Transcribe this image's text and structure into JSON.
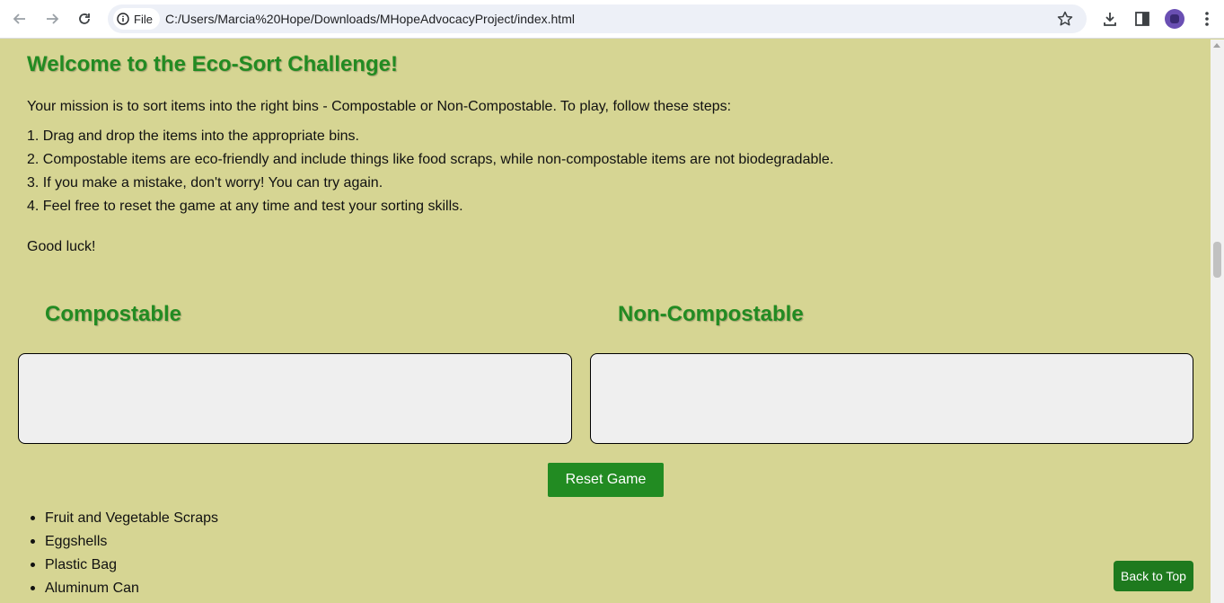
{
  "browser": {
    "chip_label": "File",
    "url": "C:/Users/Marcia%20Hope/Downloads/MHopeAdvocacyProject/index.html",
    "icons": [
      "back-arrow-icon",
      "forward-arrow-icon",
      "reload-icon",
      "info-icon",
      "star-icon",
      "download-icon",
      "side-panel-icon",
      "profile-avatar",
      "menu-dots-icon"
    ]
  },
  "page": {
    "title": "Welcome to the Eco-Sort Challenge!",
    "intro": "Your mission is to sort items into the right bins - Compostable or Non-Compostable. To play, follow these steps:",
    "steps": [
      "1. Drag and drop the items into the appropriate bins.",
      "2. Compostable items are eco-friendly and include things like food scraps, while non-compostable items are not biodegradable.",
      "3. If you make a mistake, don't worry! You can try again.",
      "4. Feel free to reset the game at any time and test your sorting skills."
    ],
    "good_luck": "Good luck!",
    "bins": {
      "compostable": "Compostable",
      "non_compostable": "Non-Compostable"
    },
    "reset_label": "Reset Game",
    "items": [
      "Fruit and Vegetable Scraps",
      "Eggshells",
      "Plastic Bag",
      "Aluminum Can"
    ],
    "back_to_top": "Back to Top"
  },
  "colors": {
    "background": "#d6d593",
    "accent_green": "#228b22",
    "bin_fill": "#efefef"
  }
}
